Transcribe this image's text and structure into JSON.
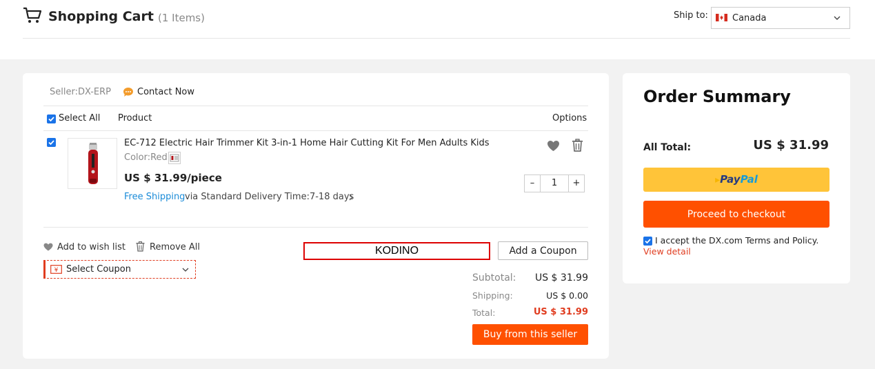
{
  "header": {
    "title": "Shopping Cart",
    "item_count": "(1 Items)",
    "ship_to_label": "Ship to:",
    "ship_to_value": "Canada"
  },
  "seller": {
    "name": "Seller:DX-ERP",
    "contact": "Contact Now"
  },
  "table": {
    "select_all": "Select All",
    "col_product": "Product",
    "col_options": "Options"
  },
  "item": {
    "name": "EC-712 Electric Hair Trimmer Kit 3-in-1 Home Hair Cutting Kit For Men Adults Kids",
    "color": "Color:Red",
    "price": "US $ 31.99/piece",
    "shipping_free": "Free Shipping",
    "shipping_via": "via Standard Delivery Time:7-18 days",
    "quantity": "1",
    "qty_minus": "–",
    "qty_plus": "+"
  },
  "actions": {
    "wishlist": "Add to wish list",
    "remove_all": "Remove All",
    "select_coupon": "Select Coupon",
    "coupon_value": "KODINO",
    "add_coupon": "Add a Coupon"
  },
  "totals": {
    "subtotal_label": "Subtotal:",
    "subtotal": "US $ 31.99",
    "shipping_label": "Shipping:",
    "shipping": "US $ 0.00",
    "total_label": "Total:",
    "total": "US $ 31.99",
    "buy_button": "Buy from this seller"
  },
  "summary": {
    "title": "Order Summary",
    "all_total_label": "All Total:",
    "all_total": "US $ 31.99",
    "paypal_part1": "Pay",
    "paypal_part2": "Pal",
    "checkout_button": "Proceed to checkout",
    "accept_text": "I accept the DX.com Terms and Policy.",
    "view_detail": "View detail"
  },
  "colors": {
    "accent": "#ff5000",
    "paypal_yellow": "#ffc439",
    "link_blue": "#1a8bd8",
    "total_red": "#e03c1f"
  },
  "icons": [
    "cart-icon",
    "canada-flag-icon",
    "chevron-down-icon",
    "chat-icon",
    "heart-icon",
    "trash-icon",
    "coupon-icon",
    "chevron-right-icon"
  ]
}
